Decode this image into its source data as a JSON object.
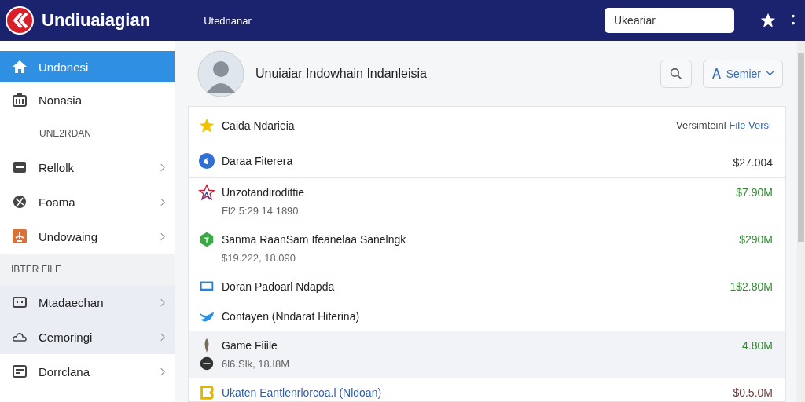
{
  "header": {
    "app_title": "Undiuaiagian",
    "nav_label": "Utednanar",
    "search": {
      "value": "Ukeariar"
    }
  },
  "sidebar": {
    "items": [
      {
        "kind": "item",
        "label": "Undonesi",
        "selected": true,
        "highlighted": false,
        "chevron": false
      },
      {
        "kind": "item",
        "label": "Nonasia",
        "selected": false,
        "highlighted": false,
        "chevron": false
      },
      {
        "kind": "section",
        "label": "UNE2RDAN"
      },
      {
        "kind": "item",
        "label": "Rellolk",
        "selected": false,
        "highlighted": false,
        "chevron": true
      },
      {
        "kind": "item",
        "label": "Foama",
        "selected": false,
        "highlighted": false,
        "chevron": true
      },
      {
        "kind": "item",
        "label": "Undowaing",
        "selected": false,
        "highlighted": false,
        "chevron": true
      },
      {
        "kind": "section",
        "label": "IBTER FILE"
      },
      {
        "kind": "item",
        "label": "Mtadaechan",
        "selected": false,
        "highlighted": true,
        "chevron": true
      },
      {
        "kind": "item",
        "label": "Cemoringi",
        "selected": false,
        "highlighted": true,
        "chevron": true
      },
      {
        "kind": "item",
        "label": "Dorrclana",
        "selected": false,
        "highlighted": false,
        "chevron": true
      }
    ]
  },
  "profile": {
    "name": "Unuiaiar Indowhain Indanleisia",
    "user_button": "Semier"
  },
  "list": {
    "title": "Caida Ndarieia",
    "version_label": "Versimteinl",
    "version_link": "File Versi",
    "rows": [
      {
        "lines": [
          "Daraa Fiterera"
        ],
        "subtitle": "",
        "amount": "$27.004",
        "color": "#333333",
        "selected": false
      },
      {
        "lines": [
          "Unzotandirodittie"
        ],
        "subtitle": "Fl2 5:29 14 1890",
        "amount": "$7.90M",
        "color": "#2e8b2e",
        "selected": false
      },
      {
        "lines": [
          "Sanma RaanSam Ifeanelaa Sanelngk"
        ],
        "subtitle": "$19.222, 18.090",
        "amount": "$290M",
        "color": "#2e8b2e",
        "selected": false
      },
      {
        "lines": [
          "Doran Padoarl Ndapda",
          "Contayen (Nndarat Hiterina)"
        ],
        "subtitle": "",
        "amount": "1$2.80M",
        "color": "#2e8b2e",
        "selected": false
      },
      {
        "lines": [
          "Game Fiiile"
        ],
        "subtitle": "6l6.Slk, 18.I8M",
        "amount": "4.80M",
        "color": "#2e8b2e",
        "selected": true
      },
      {
        "lines": [
          "Ukaten Eantlenrlorcoa.l (Nldoan)"
        ],
        "subtitle": "",
        "amount": "$0.5.0M",
        "color": "#6a3b3b",
        "selected": false
      }
    ]
  }
}
